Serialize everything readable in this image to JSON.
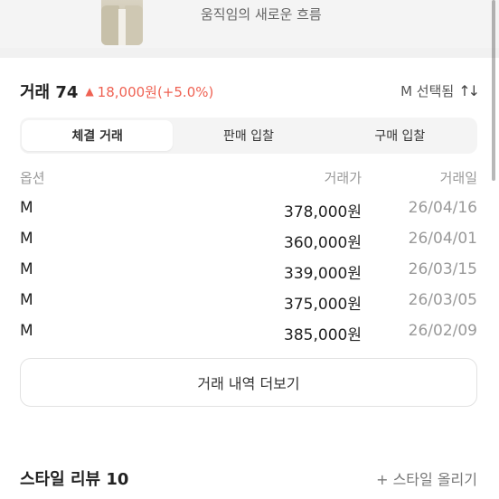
{
  "banner": {
    "text": "움직임의 새로운 흐름"
  },
  "trade": {
    "title": "거래 74",
    "change_arrow": "▲",
    "change_text": "18,000원(+5.0%)",
    "size_selected": "M 선택됨",
    "sort_icon": "↑↓"
  },
  "tabs": [
    {
      "label": "체결 거래",
      "active": true
    },
    {
      "label": "판매 입찰",
      "active": false
    },
    {
      "label": "구매 입찰",
      "active": false
    }
  ],
  "table": {
    "headers": {
      "option": "옵션",
      "price": "거래가",
      "date": "거래일"
    },
    "rows": [
      {
        "option": "M",
        "price": "378,000원",
        "date": "26/04/16"
      },
      {
        "option": "M",
        "price": "360,000원",
        "date": "26/04/01"
      },
      {
        "option": "M",
        "price": "339,000원",
        "date": "26/03/15"
      },
      {
        "option": "M",
        "price": "375,000원",
        "date": "26/03/05"
      },
      {
        "option": "M",
        "price": "385,000원",
        "date": "26/02/09"
      }
    ]
  },
  "more_button": "거래 내역 더보기",
  "style_section": {
    "title": "스타일 리뷰 10",
    "upload": "+ 스타일 올리기"
  },
  "colors": {
    "accent_red": "#ef6253",
    "muted_gray": "#999999",
    "tab_bg": "#f4f4f4"
  }
}
